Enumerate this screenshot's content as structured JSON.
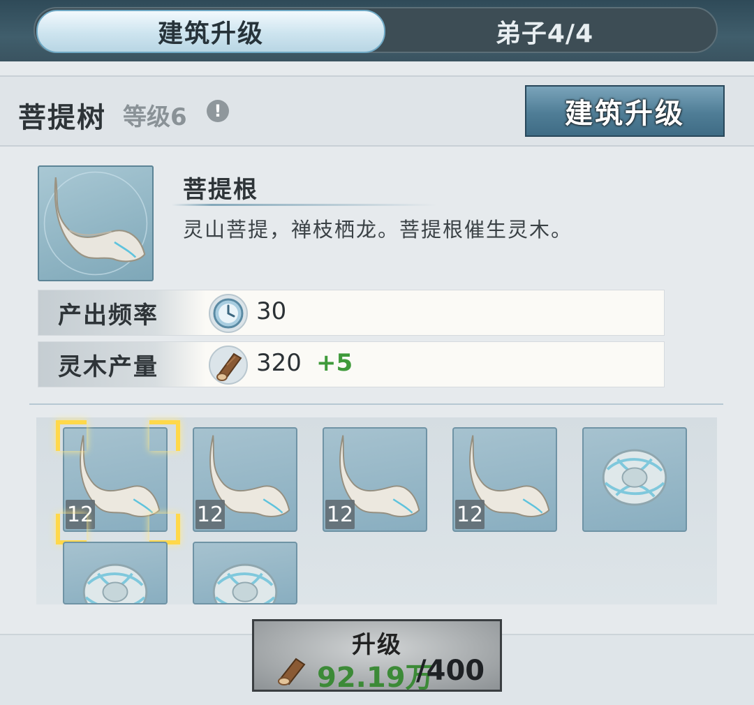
{
  "tabs": {
    "active_label": "建筑升级",
    "disciples_label": "弟子4/4"
  },
  "header": {
    "building_name": "菩提树",
    "level_text": "等级6",
    "info_icon": "!",
    "upgrade_button_label": "建筑升级"
  },
  "item": {
    "icon": "bodhi-root-icon",
    "name": "菩提根",
    "description": "灵山菩提，禅枝栖龙。菩提根催生灵木。"
  },
  "stats": [
    {
      "label": "产出频率",
      "icon": "clock-icon",
      "value": "30",
      "bonus": ""
    },
    {
      "label": "灵木产量",
      "icon": "wood-log-icon",
      "value": "320",
      "bonus": "+5"
    }
  ],
  "slots": [
    {
      "icon": "bodhi-root-icon",
      "count": "12",
      "selected": true
    },
    {
      "icon": "bodhi-root-icon",
      "count": "12",
      "selected": false
    },
    {
      "icon": "bodhi-root-icon",
      "count": "12",
      "selected": false
    },
    {
      "icon": "bodhi-root-icon",
      "count": "12",
      "selected": false
    },
    {
      "icon": "spirit-nest-icon",
      "count": "",
      "selected": false
    },
    {
      "icon": "spirit-nest-icon",
      "count": "",
      "selected": false
    },
    {
      "icon": "spirit-nest-icon",
      "count": "",
      "selected": false
    }
  ],
  "upgrade": {
    "label": "升级",
    "cost_icon": "wood-log-icon",
    "have": "92.19万",
    "need": "/400"
  },
  "colors": {
    "accent_green": "#3e9a3a",
    "selection_gold": "#ffd84a"
  }
}
